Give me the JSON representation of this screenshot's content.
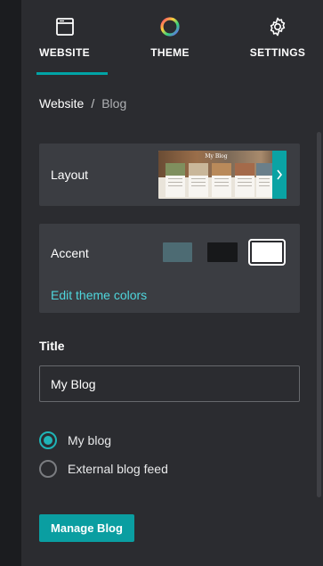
{
  "tabs": {
    "website": {
      "label": "WEBSITE",
      "icon": "browser-window-icon",
      "active": true
    },
    "theme": {
      "label": "THEME",
      "icon": "color-wheel-icon"
    },
    "settings": {
      "label": "SETTINGS",
      "icon": "gear-icon"
    }
  },
  "breadcrumb": {
    "parent": "Website",
    "separator": "/",
    "current": "Blog"
  },
  "layout": {
    "label": "Layout",
    "thumbnail_title": "My Blog",
    "next_icon": "chevron-right-icon"
  },
  "accent": {
    "label": "Accent",
    "swatches": [
      {
        "name": "teal",
        "color": "#4d6b73"
      },
      {
        "name": "black",
        "color": "#17181a"
      },
      {
        "name": "white",
        "color": "#ffffff",
        "selected": true
      }
    ],
    "edit_link": "Edit theme colors"
  },
  "title": {
    "label": "Title",
    "value": "My Blog"
  },
  "source": {
    "options": [
      {
        "label": "My blog",
        "checked": true
      },
      {
        "label": "External blog feed",
        "checked": false
      }
    ]
  },
  "manage_button": {
    "label": "Manage Blog"
  },
  "colors": {
    "accent": "#00a4a6",
    "link": "#4fd6dc",
    "panel": "#2b2c30",
    "card": "#3b3d42"
  }
}
